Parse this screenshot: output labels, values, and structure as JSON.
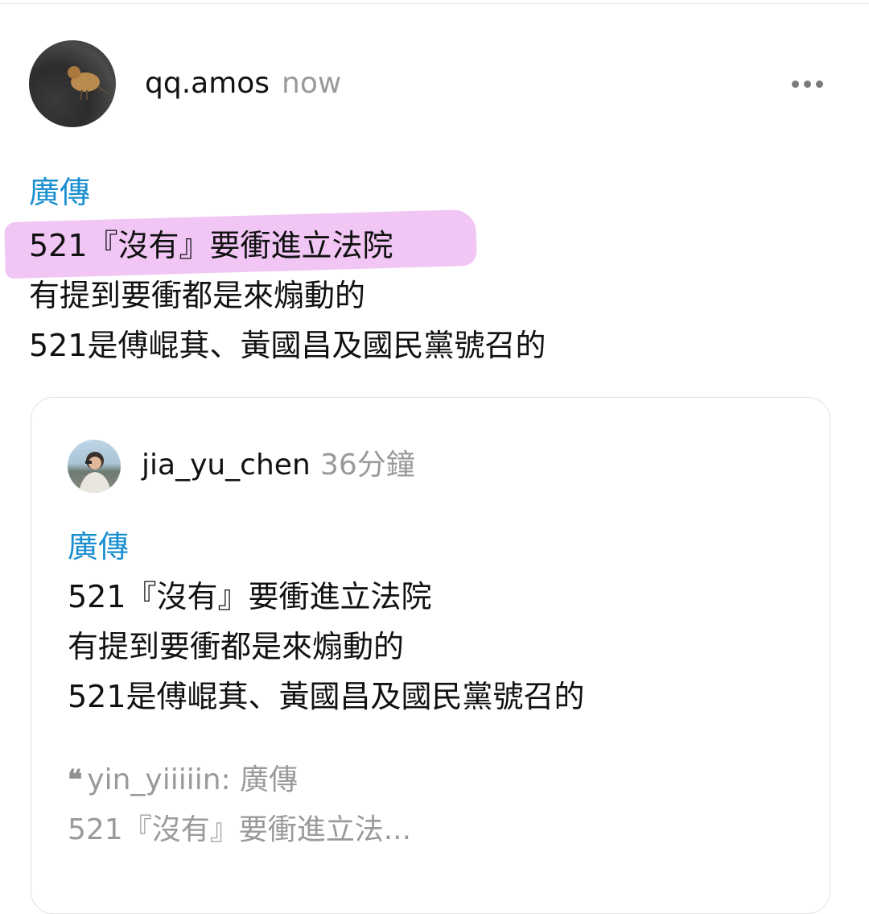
{
  "post": {
    "username": "qq.amos",
    "timestamp": "now",
    "more_icon": "more-horizontal-icon",
    "tag": "廣傳",
    "lines": [
      "521『沒有』要衝進立法院",
      "有提到要衝都是來煽動的",
      "521是傅崐萁、黃國昌及國民黨號召的"
    ],
    "highlight_color": "#f1c6f4",
    "tag_color": "#1a8fd0"
  },
  "quoted": {
    "username": "jia_yu_chen",
    "timestamp": "36分鐘",
    "tag": "廣傳",
    "lines": [
      "521『沒有』要衝進立法院",
      "有提到要衝都是來煽動的",
      "521是傅崐萁、黃國昌及國民黨號召的"
    ],
    "nested_quote": {
      "icon": "quote-icon",
      "line1": "yin_yiiiiin: 廣傳",
      "line2": "521『沒有』要衝進立法..."
    }
  }
}
